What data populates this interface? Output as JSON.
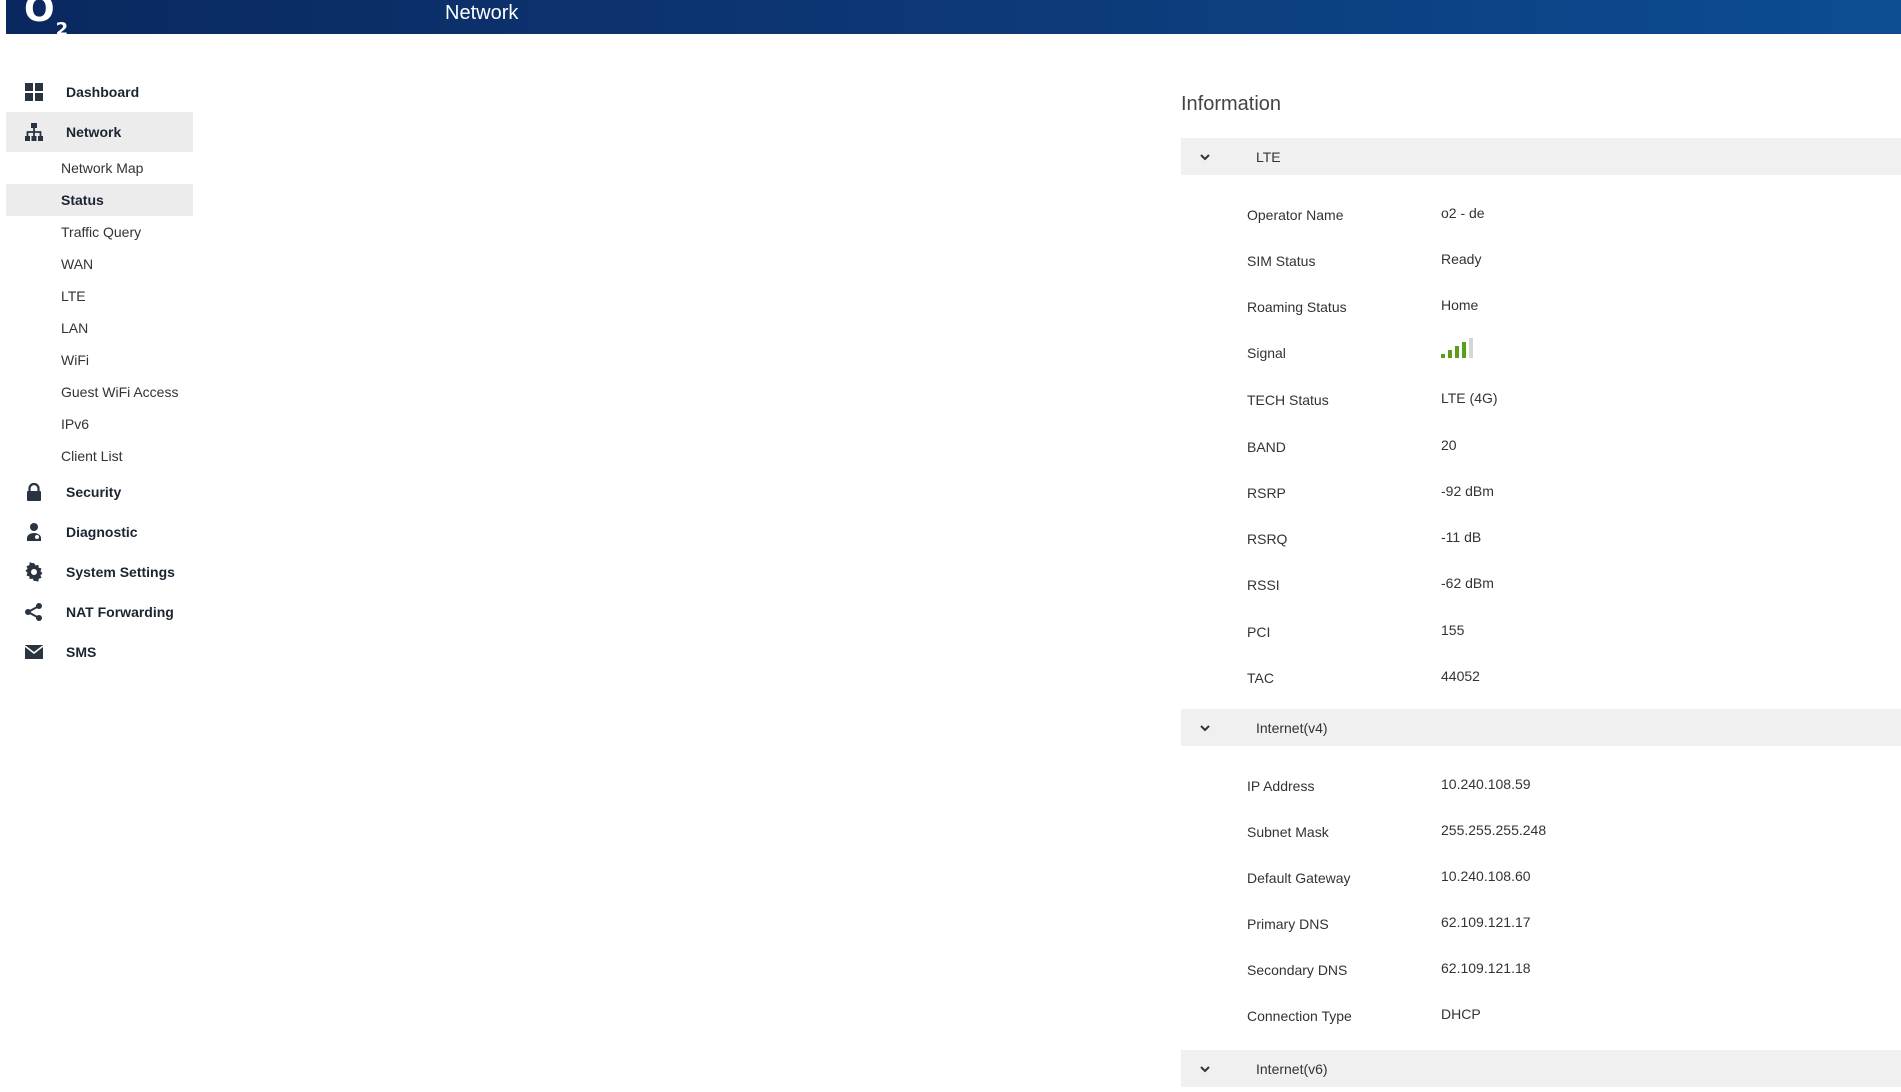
{
  "header": {
    "logo": "O",
    "logo_sub": "2",
    "title": "Network",
    "brand_color": "#0d3a78"
  },
  "sidebar": {
    "items": [
      {
        "label": "Dashboard",
        "icon": "dashboard-icon"
      },
      {
        "label": "Network",
        "icon": "network-icon",
        "active": true
      },
      {
        "label": "Security",
        "icon": "lock-icon"
      },
      {
        "label": "Diagnostic",
        "icon": "diagnostic-icon"
      },
      {
        "label": "System Settings",
        "icon": "gear-icon"
      },
      {
        "label": "NAT Forwarding",
        "icon": "share-icon"
      },
      {
        "label": "SMS",
        "icon": "envelope-icon"
      }
    ],
    "network_sub": [
      {
        "label": "Network Map"
      },
      {
        "label": "Status",
        "active": true
      },
      {
        "label": "Traffic Query"
      },
      {
        "label": "WAN"
      },
      {
        "label": "LTE"
      },
      {
        "label": "LAN"
      },
      {
        "label": "WiFi"
      },
      {
        "label": "Guest WiFi Access"
      },
      {
        "label": "IPv6"
      },
      {
        "label": "Client List"
      }
    ]
  },
  "main": {
    "title": "Information",
    "sections": [
      {
        "label": "LTE",
        "icon": "chevron-down-icon",
        "rows": [
          {
            "label": "Operator Name",
            "value": "o2 - de"
          },
          {
            "label": "SIM Status",
            "value": "Ready"
          },
          {
            "label": "Roaming Status",
            "value": "Home"
          },
          {
            "label": "Signal",
            "value": "",
            "signal_level": 4,
            "signal_max": 5,
            "signal_color": "#5a9e1c"
          },
          {
            "label": "TECH Status",
            "value": "LTE (4G)"
          },
          {
            "label": "BAND",
            "value": "20"
          },
          {
            "label": "RSRP",
            "value": "-92 dBm"
          },
          {
            "label": "RSRQ",
            "value": "-11 dB"
          },
          {
            "label": "RSSI",
            "value": "-62 dBm"
          },
          {
            "label": "PCI",
            "value": "155"
          },
          {
            "label": "TAC",
            "value": "44052"
          }
        ]
      },
      {
        "label": "Internet(v4)",
        "icon": "chevron-down-icon",
        "rows": [
          {
            "label": "IP Address",
            "value": "10.240.108.59"
          },
          {
            "label": "Subnet Mask",
            "value": "255.255.255.248"
          },
          {
            "label": "Default Gateway",
            "value": "10.240.108.60"
          },
          {
            "label": "Primary DNS",
            "value": "62.109.121.17"
          },
          {
            "label": "Secondary DNS",
            "value": "62.109.121.18"
          },
          {
            "label": "Connection Type",
            "value": "DHCP"
          }
        ]
      },
      {
        "label": "Internet(v6)",
        "icon": "chevron-down-icon",
        "rows": []
      }
    ]
  }
}
